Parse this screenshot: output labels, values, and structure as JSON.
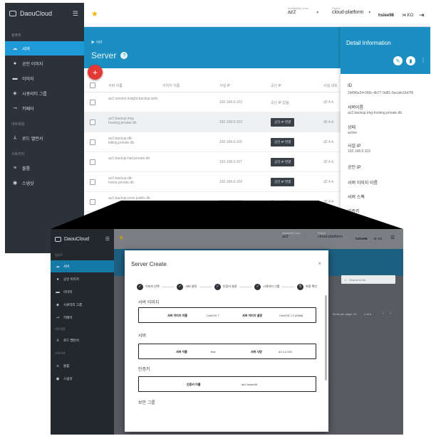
{
  "shot1": {
    "brand": "DaouCloud",
    "sidebar": {
      "section1": "컴퓨트",
      "items": [
        {
          "label": "서버",
          "icon": "cloud-icon",
          "active": true
        },
        {
          "label": "공인 이미지",
          "icon": "globe-icon"
        },
        {
          "label": "이미지",
          "icon": "image-icon"
        },
        {
          "label": "시큐리티 그룹",
          "icon": "shield-icon"
        },
        {
          "label": "키페어",
          "icon": "key-icon"
        }
      ],
      "section2": "네트워킹",
      "net_items": [
        {
          "label": "로드 밸런서",
          "icon": "loadbalancer-icon"
        }
      ],
      "section3": "스토리지",
      "storage_items": [
        {
          "label": "볼륨",
          "icon": "volume-icon"
        },
        {
          "label": "스냅샷",
          "icon": "snapshot-icon"
        }
      ]
    },
    "topbar": {
      "zone_caption": "Availability Zone",
      "zone": "az2",
      "project_caption": "Project",
      "project": "cloud-platform",
      "user": "hslee98",
      "lang": "KO"
    },
    "page": {
      "breadcrumb": "▶ 서버",
      "title": "Server",
      "columns": [
        "서버 이름",
        "이미지 이름",
        "사설 IP",
        "공인 IP",
        "사설 네트"
      ],
      "rows": [
        {
          "name": "az2.service.insight.backup.web",
          "private_ip": "192.168.0.102",
          "public": "공인 IP 없음",
          "net": "d2.4.4.",
          "btn": false,
          "hl": false
        },
        {
          "name": "az2.backup.img-hosting.private.db",
          "private_ip": "192.168.0.103",
          "public": "공인 IP 연결",
          "net": "d2.4.4.",
          "btn": true,
          "hl": true
        },
        {
          "name": "az2.backup.db-billing.private.db",
          "private_ip": "192.168.0.106",
          "public": "공인 IP 연결",
          "net": "d2.4.4.",
          "btn": true,
          "hl": false
        },
        {
          "name": "az2.backup.hail.private.db",
          "private_ip": "192.168.0.107",
          "public": "공인 IP 연결",
          "net": "d2.4.4.",
          "btn": true,
          "hl": false
        },
        {
          "name": "az2.backup.db-home.private.db",
          "private_ip": "192.168.0.109",
          "public": "공인 IP 연결",
          "net": "d2.4.4.",
          "btn": true,
          "hl": false
        },
        {
          "name": "az2.backup.pces.public.db",
          "private_ip": "192.168.0.104",
          "public": "공인 IP 없음",
          "net": "d2.4.4.",
          "btn": false,
          "hl": false
        }
      ]
    },
    "detail": {
      "title": "Detail Information",
      "fields": [
        {
          "label": "ID",
          "value": "2d496e34-066c-4b77-9d81-6ecafe16d7f6"
        },
        {
          "label": "서버이름",
          "value": "az2.backup.img-hosting.private.db"
        },
        {
          "label": "상태",
          "value": "active"
        },
        {
          "label": "사설 IP",
          "value": "192.168.0.103"
        },
        {
          "label": "공인 IP",
          "value": ""
        },
        {
          "label": "서버 이미지 이름",
          "value": ""
        },
        {
          "label": "서버 스펙",
          "value": ""
        },
        {
          "label": "인증키",
          "value": ""
        }
      ]
    }
  },
  "shot2": {
    "brand": "DaouCloud",
    "sidebar": {
      "section1": "컴퓨트",
      "items": [
        {
          "label": "서버",
          "icon": "cloud-icon",
          "active": true
        },
        {
          "label": "공인 이미지",
          "icon": "globe-icon"
        },
        {
          "label": "이미지",
          "icon": "image-icon"
        },
        {
          "label": "시큐리티 그룹",
          "icon": "shield-icon"
        },
        {
          "label": "키페어",
          "icon": "key-icon"
        }
      ],
      "section2": "네트워킹",
      "net_items": [
        {
          "label": "로드 밸런서",
          "icon": "loadbalancer-icon"
        }
      ],
      "section3": "스토리지",
      "storage_items": [
        {
          "label": "볼륨",
          "icon": "volume-icon"
        },
        {
          "label": "스냅샷",
          "icon": "snapshot-icon"
        }
      ]
    },
    "topbar": {
      "zone_caption": "Availability Zone",
      "zone": "az2",
      "project_caption": "Project",
      "project": "cloud-platform",
      "user": "hslee98",
      "lang": "KO"
    },
    "search_placeholder": "Search in list",
    "pagination": {
      "per_page_label": "Items per page:",
      "per_page": "10",
      "range": "1 of 6"
    },
    "modal": {
      "title": "Server Create",
      "close": "×",
      "steps": [
        {
          "n": "✓",
          "label": "이미지 선택"
        },
        {
          "n": "✓",
          "label": "서버 설정"
        },
        {
          "n": "✓",
          "label": "인증키 설정"
        },
        {
          "n": "✓",
          "label": "시큐리티 그룹"
        },
        {
          "n": "5",
          "label": "최종 확인"
        }
      ],
      "sections": {
        "image": {
          "title": "서버 이미지",
          "k1": "서버 이미지 이름",
          "v1": "CentOS 7",
          "k2": "서버 이미지 설명",
          "v2": "CentOS 7.2 (64bit)"
        },
        "server": {
          "title": "서버",
          "k1": "서버 이름",
          "v1": "test",
          "k2": "서버 사양",
          "v2": "d2.4.4.100"
        },
        "keypair": {
          "title": "인증키",
          "k1": "인증키 이름",
          "v1": "az2-hslee98"
        },
        "secgroup": {
          "title": "보안 그룹"
        }
      }
    }
  }
}
